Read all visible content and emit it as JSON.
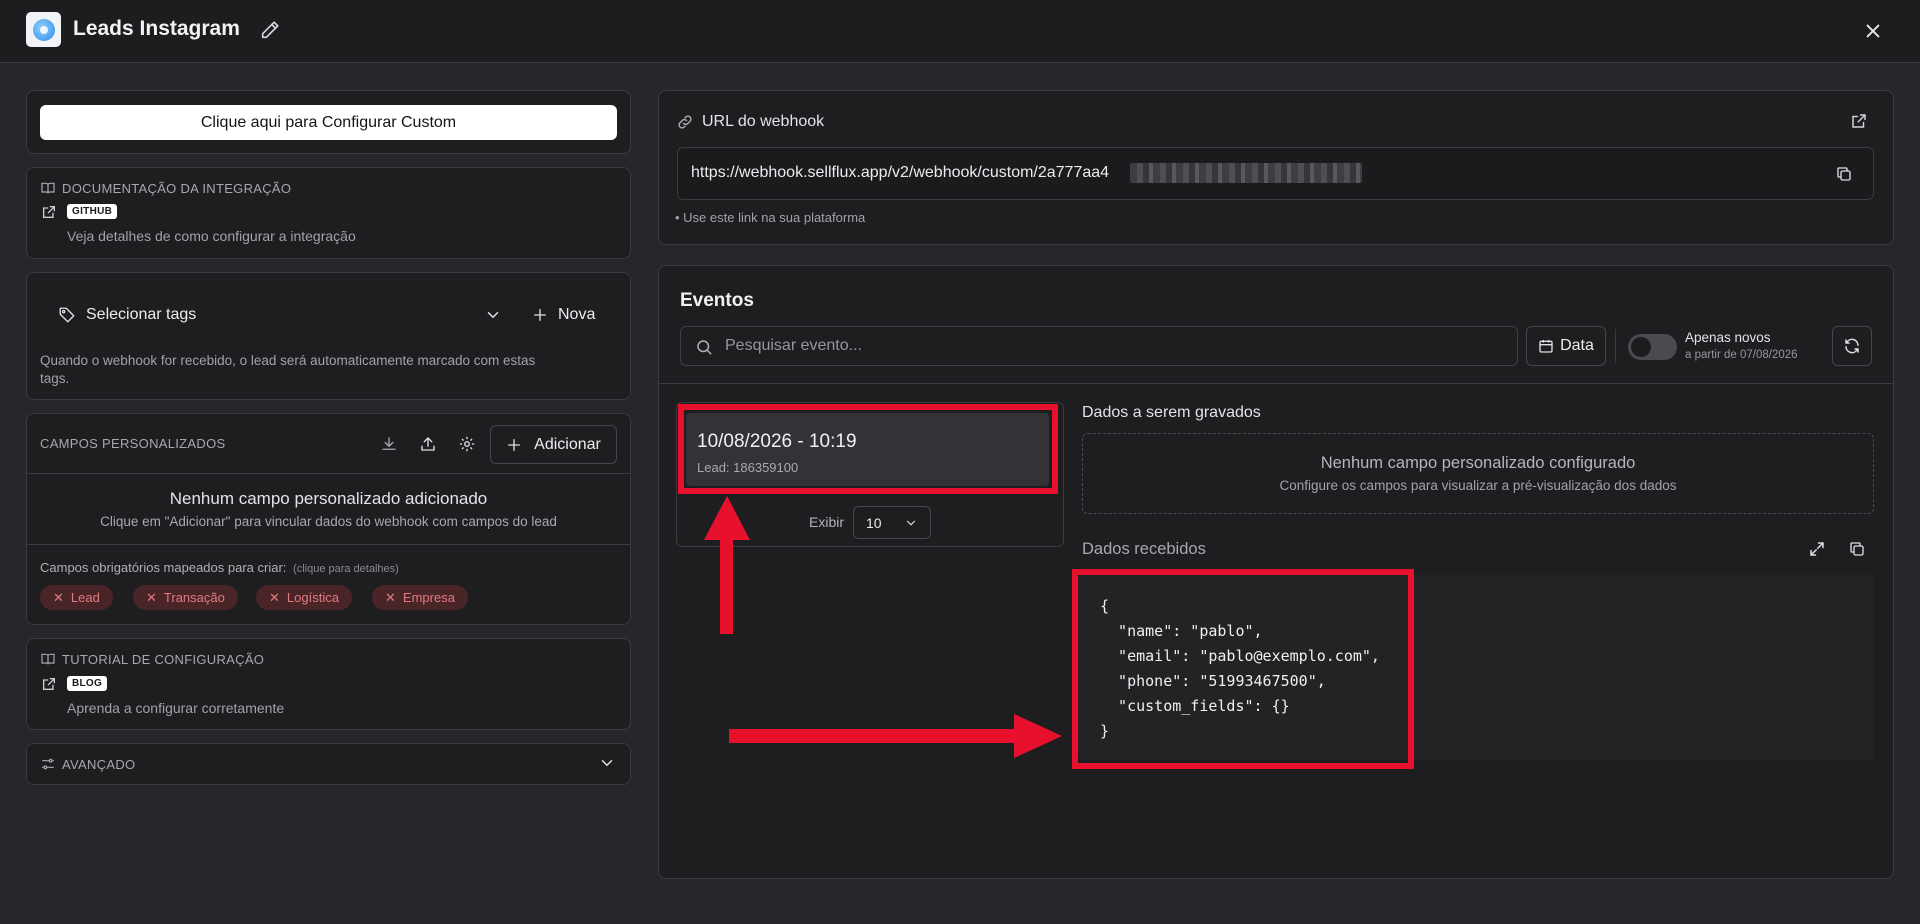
{
  "header": {
    "title": "Leads Instagram"
  },
  "left": {
    "configure_button": "Clique aqui para Configurar Custom",
    "docs": {
      "heading": "DOCUMENTAÇÃO DA INTEGRAÇÃO",
      "badge": "GITHUB",
      "description": "Veja detalhes de como configurar a integração"
    },
    "tags": {
      "select_label": "Selecionar tags",
      "new_label": "Nova",
      "help_line1": "Quando o webhook for recebido, o lead será automaticamente marcado com estas",
      "help_line2": "tags."
    },
    "custom_fields": {
      "heading": "CAMPOS PERSONALIZADOS",
      "add_label": "Adicionar",
      "empty_title": "Nenhum campo personalizado adicionado",
      "empty_subtitle": "Clique em \"Adicionar\" para vincular dados do webhook com campos do lead",
      "required_label": "Campos obrigatórios mapeados para criar:",
      "required_hint": "(clique para detalhes)",
      "chips": [
        "Lead",
        "Transação",
        "Logística",
        "Empresa"
      ]
    },
    "tutorial": {
      "heading": "TUTORIAL DE CONFIGURAÇÃO",
      "badge": "BLOG",
      "description": "Aprenda a configurar corretamente"
    },
    "advanced": {
      "heading": "AVANÇADO"
    }
  },
  "webhook": {
    "heading": "URL do webhook",
    "url": "https://webhook.sellflux.app/v2/webhook/custom/2a777aa4",
    "hint": "• Use este link na sua plataforma"
  },
  "events": {
    "heading": "Eventos",
    "search_placeholder": "Pesquisar evento...",
    "date_button": "Data",
    "toggle_label": "Apenas novos",
    "toggle_sub": "a partir de 07/08/2026",
    "toggle_on": false,
    "items": [
      {
        "date": "10/08/2026 - 10:19",
        "lead": "Lead: 186359100"
      }
    ],
    "show_label": "Exibir",
    "show_value": "10",
    "data_to_save": {
      "heading": "Dados a serem gravados",
      "empty_title": "Nenhum campo personalizado configurado",
      "empty_subtitle": "Configure os campos para visualizar a pré-visualização dos dados"
    },
    "received": {
      "heading": "Dados recebidos",
      "json": "{\n  \"name\": \"pablo\",\n  \"email\": \"pablo@exemplo.com\",\n  \"phone\": \"51993467500\",\n  \"custom_fields\": {}\n}"
    }
  },
  "colors": {
    "background": "#27272b",
    "panel": "#1e1e21",
    "border": "#3a3a3f",
    "highlight_red": "#e8112d",
    "chip_bg": "#4a2528",
    "chip_text": "#e07a82"
  }
}
